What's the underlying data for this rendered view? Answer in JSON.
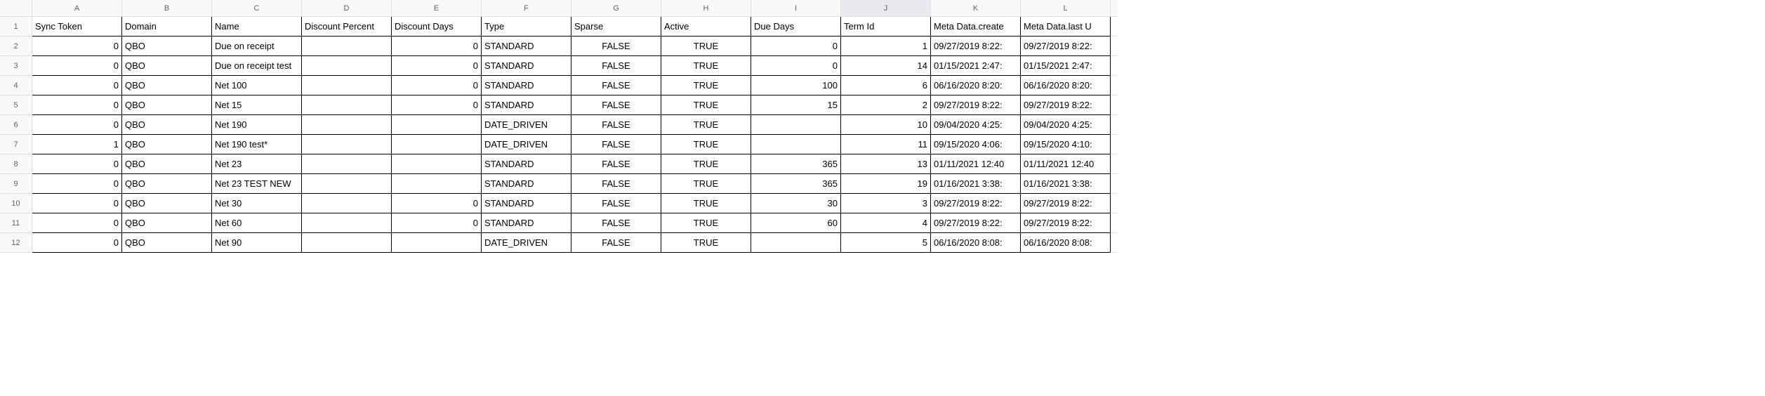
{
  "columns": [
    "A",
    "B",
    "C",
    "D",
    "E",
    "F",
    "G",
    "H",
    "I",
    "J",
    "K",
    "L"
  ],
  "selectedColumn": "J",
  "rowNumbers": [
    1,
    2,
    3,
    4,
    5,
    6,
    7,
    8,
    9,
    10,
    11,
    12
  ],
  "headers": {
    "A": "Sync Token",
    "B": "Domain",
    "C": "Name",
    "D": "Discount Percent",
    "E": "Discount Days",
    "F": "Type",
    "G": "Sparse",
    "H": "Active",
    "I": "Due Days",
    "J": "Term Id",
    "K": "Meta Data.create",
    "L": "Meta Data.last U"
  },
  "rows": [
    {
      "A": "0",
      "B": "QBO",
      "C": "Due on receipt",
      "D": "",
      "E": "0",
      "F": "STANDARD",
      "G": "FALSE",
      "H": "TRUE",
      "I": "0",
      "J": "1",
      "K": "09/27/2019 8:22:",
      "L": "09/27/2019 8:22:"
    },
    {
      "A": "0",
      "B": "QBO",
      "C": "Due on receipt test",
      "D": "",
      "E": "0",
      "F": "STANDARD",
      "G": "FALSE",
      "H": "TRUE",
      "I": "0",
      "J": "14",
      "K": "01/15/2021 2:47:",
      "L": "01/15/2021 2:47:"
    },
    {
      "A": "0",
      "B": "QBO",
      "C": "Net 100",
      "D": "",
      "E": "0",
      "F": "STANDARD",
      "G": "FALSE",
      "H": "TRUE",
      "I": "100",
      "J": "6",
      "K": "06/16/2020 8:20:",
      "L": "06/16/2020 8:20:"
    },
    {
      "A": "0",
      "B": "QBO",
      "C": "Net 15",
      "D": "",
      "E": "0",
      "F": "STANDARD",
      "G": "FALSE",
      "H": "TRUE",
      "I": "15",
      "J": "2",
      "K": "09/27/2019 8:22:",
      "L": "09/27/2019 8:22:"
    },
    {
      "A": "0",
      "B": "QBO",
      "C": "Net 190",
      "D": "",
      "E": "",
      "F": "DATE_DRIVEN",
      "G": "FALSE",
      "H": "TRUE",
      "I": "",
      "J": "10",
      "K": "09/04/2020 4:25:",
      "L": "09/04/2020 4:25:"
    },
    {
      "A": "1",
      "B": "QBO",
      "C": "Net 190 test*",
      "D": "",
      "E": "",
      "F": "DATE_DRIVEN",
      "G": "FALSE",
      "H": "TRUE",
      "I": "",
      "J": "11",
      "K": "09/15/2020 4:06:",
      "L": "09/15/2020 4:10:"
    },
    {
      "A": "0",
      "B": "QBO",
      "C": "Net 23",
      "D": "",
      "E": "",
      "F": "STANDARD",
      "G": "FALSE",
      "H": "TRUE",
      "I": "365",
      "J": "13",
      "K": "01/11/2021 12:40",
      "L": "01/11/2021 12:40"
    },
    {
      "A": "0",
      "B": "QBO",
      "C": "Net 23 TEST NEW",
      "D": "",
      "E": "",
      "F": "STANDARD",
      "G": "FALSE",
      "H": "TRUE",
      "I": "365",
      "J": "19",
      "K": "01/16/2021 3:38:",
      "L": "01/16/2021 3:38:"
    },
    {
      "A": "0",
      "B": "QBO",
      "C": "Net 30",
      "D": "",
      "E": "0",
      "F": "STANDARD",
      "G": "FALSE",
      "H": "TRUE",
      "I": "30",
      "J": "3",
      "K": "09/27/2019 8:22:",
      "L": "09/27/2019 8:22:"
    },
    {
      "A": "0",
      "B": "QBO",
      "C": "Net 60",
      "D": "",
      "E": "0",
      "F": "STANDARD",
      "G": "FALSE",
      "H": "TRUE",
      "I": "60",
      "J": "4",
      "K": "09/27/2019 8:22:",
      "L": "09/27/2019 8:22:"
    },
    {
      "A": "0",
      "B": "QBO",
      "C": "Net 90",
      "D": "",
      "E": "",
      "F": "DATE_DRIVEN",
      "G": "FALSE",
      "H": "TRUE",
      "I": "",
      "J": "5",
      "K": "06/16/2020 8:08:",
      "L": "06/16/2020 8:08:"
    }
  ],
  "alignments": {
    "A": "right",
    "B": "left",
    "C": "left",
    "D": "left",
    "E": "right",
    "F": "left",
    "G": "center",
    "H": "center",
    "I": "right",
    "J": "right",
    "K": "left",
    "L": "left"
  },
  "headerAlignments": {
    "A": "left",
    "B": "left",
    "C": "left",
    "D": "left",
    "E": "left",
    "F": "left",
    "G": "left",
    "H": "left",
    "I": "left",
    "J": "left",
    "K": "left",
    "L": "left"
  }
}
